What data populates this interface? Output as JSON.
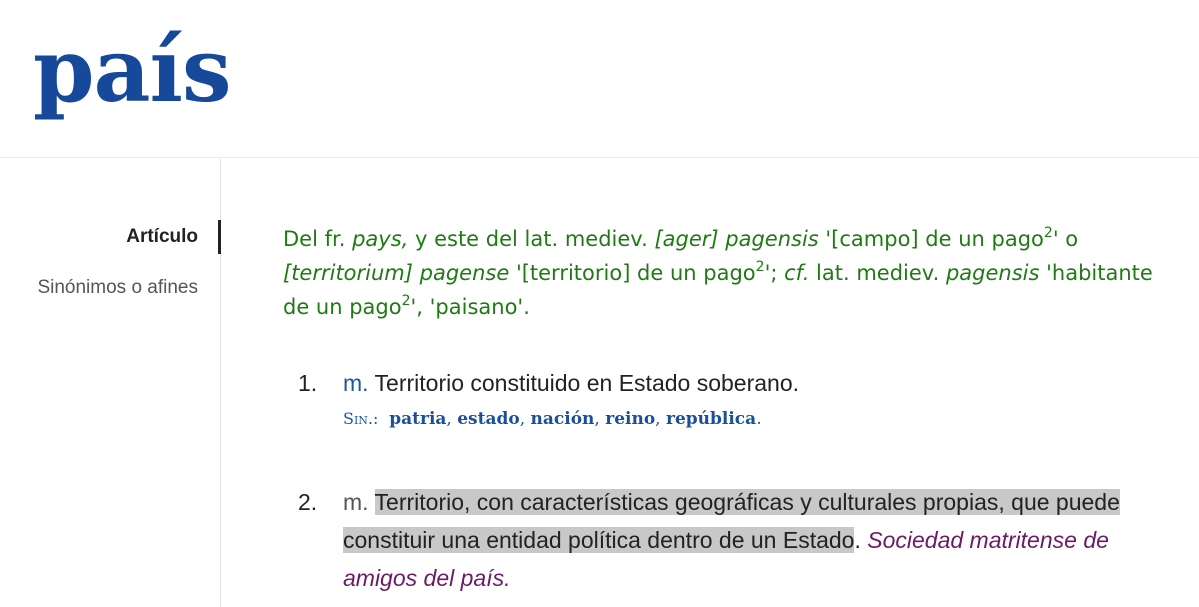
{
  "headword": "país",
  "nav": {
    "items": [
      {
        "label": "Artículo"
      },
      {
        "label": "Sinónimos o afines"
      }
    ]
  },
  "etymology": {
    "l1_a": "Del fr. ",
    "l1_b": "pays,",
    "l1_c": " y este del lat. mediev. ",
    "l1_d": "[ager] pagensis",
    "l1_e": " '[campo] de un pago",
    "l1_sup": "2",
    "l1_f": "' o",
    "l2_a": "[territorium] pagense",
    "l2_b": " '[territorio] de un pago",
    "l2_sup": "2",
    "l2_c": "'; ",
    "l2_d": "cf.",
    "l2_e": " lat. mediev. ",
    "l2_f": "pagensis",
    "l2_g": " 'habitante",
    "l3_a": "de un pago",
    "l3_sup": "2",
    "l3_b": "', 'paisano'."
  },
  "acepciones": [
    {
      "num": "1.",
      "abbr": "m.",
      "text": " Territorio constituido en Estado soberano.",
      "sin_label": "Sin.:",
      "synonyms": [
        "patria",
        "estado",
        "nación",
        "reino",
        "república"
      ],
      "sep": ", ",
      "end": "."
    },
    {
      "num": "2.",
      "abbr": "m.",
      "text_l1": "Territorio, con características geográficas y culturales propias, que puede",
      "text_l2": "constituir una entidad política dentro de un Estado",
      "text_l2_end": ".",
      "example_l2": " Sociedad matritense de",
      "example_l3": "amigos del país."
    }
  ]
}
